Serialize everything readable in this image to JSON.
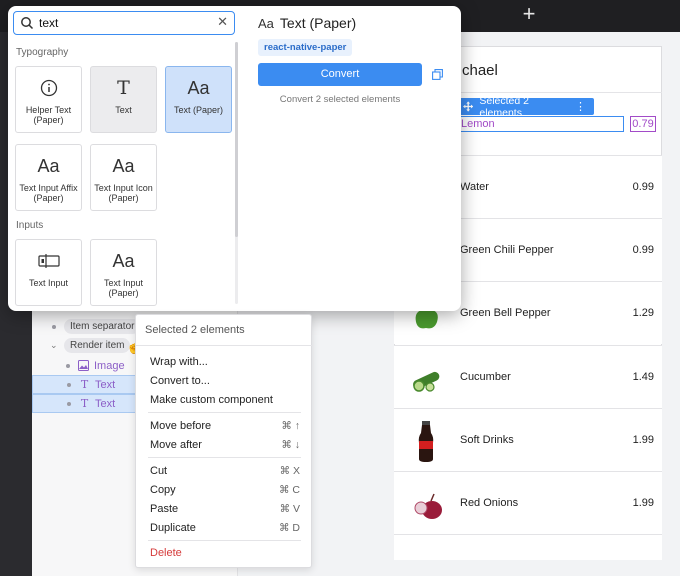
{
  "search": {
    "value": "text",
    "placeholder": ""
  },
  "sections": {
    "typography": "Typography",
    "inputs": "Inputs"
  },
  "tiles": [
    {
      "label": "Helper Text (Paper)",
      "icon": "info-circle-icon"
    },
    {
      "label": "Text",
      "icon": "text-t-icon"
    },
    {
      "label": "Text (Paper)",
      "icon": "text-aa-icon"
    },
    {
      "label": "Text Input Affix (Paper)",
      "icon": "text-aa-icon"
    },
    {
      "label": "Text Input Icon (Paper)",
      "icon": "text-aa-icon"
    },
    {
      "label": "Text Input",
      "icon": "text-input-icon"
    },
    {
      "label": "Text Input (Paper)",
      "icon": "text-aa-icon"
    }
  ],
  "detail": {
    "icon_glyph": "Aa",
    "title": "Text (Paper)",
    "package": "react-native-paper",
    "convert_label": "Convert",
    "note": "Convert 2 selected elements"
  },
  "layers": {
    "item_separator": "Item separator",
    "render_item": "Render item",
    "image": "Image",
    "text1": "Text",
    "text2": "Text"
  },
  "context_menu": {
    "header": "Selected 2 elements",
    "items": [
      {
        "label": "Wrap with...",
        "shortcut": ""
      },
      {
        "label": "Convert to...",
        "shortcut": ""
      },
      {
        "label": "Make custom component",
        "shortcut": ""
      },
      {
        "label": "Move before",
        "shortcut": "⌘ ↑"
      },
      {
        "label": "Move after",
        "shortcut": "⌘ ↓"
      },
      {
        "label": "Cut",
        "shortcut": "⌘ X"
      },
      {
        "label": "Copy",
        "shortcut": "⌘ C"
      },
      {
        "label": "Paste",
        "shortcut": "⌘ V"
      },
      {
        "label": "Duplicate",
        "shortcut": "⌘ D"
      },
      {
        "label": "Delete",
        "shortcut": ""
      }
    ]
  },
  "canvas": {
    "title_partial": "chael",
    "selection_badge": "Selected 2 elements",
    "selection_more": "⋮",
    "selected_name": "Lemon",
    "selected_price": "0.79",
    "products": [
      {
        "name": "Water",
        "price": "0.99"
      },
      {
        "name": "Green Chili Pepper",
        "price": "0.99"
      },
      {
        "name": "Green Bell Pepper",
        "price": "1.29"
      },
      {
        "name": "Cucumber",
        "price": "1.49"
      },
      {
        "name": "Soft Drinks",
        "price": "1.99"
      },
      {
        "name": "Red Onions",
        "price": "1.99"
      }
    ]
  },
  "topbar": {
    "add_glyph": "+"
  },
  "colors": {
    "accent": "#3b8cf1",
    "selection_text": "#a24bc8",
    "delete": "#d53b3b"
  }
}
